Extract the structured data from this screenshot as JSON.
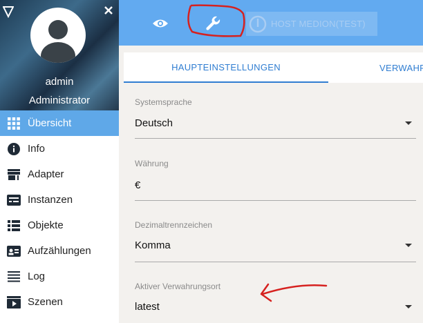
{
  "sidebar": {
    "user": {
      "name": "admin",
      "role": "Administrator"
    },
    "items": [
      {
        "label": "Übersicht",
        "icon": "grid-icon",
        "active": true
      },
      {
        "label": "Info",
        "icon": "info-icon"
      },
      {
        "label": "Adapter",
        "icon": "store-icon"
      },
      {
        "label": "Instanzen",
        "icon": "instances-icon"
      },
      {
        "label": "Objekte",
        "icon": "list-icon"
      },
      {
        "label": "Aufzählungen",
        "icon": "badge-icon"
      },
      {
        "label": "Log",
        "icon": "lines-icon"
      },
      {
        "label": "Szenen",
        "icon": "play-icon"
      }
    ]
  },
  "header": {
    "host_label": "HOST MEDION(TEST)",
    "icons": [
      "eye-icon",
      "wrench-icon",
      "power-icon"
    ]
  },
  "tabs": [
    {
      "label": "HAUPTEINSTELLUNGEN",
      "active": true
    },
    {
      "label": "VERWAHR"
    }
  ],
  "form": {
    "language": {
      "label": "Systemsprache",
      "value": "Deutsch"
    },
    "currency": {
      "label": "Währung",
      "value": "€"
    },
    "decimal": {
      "label": "Dezimaltrennzeichen",
      "value": "Komma"
    },
    "storage": {
      "label": "Aktiver Verwahrungsort",
      "value": "latest"
    }
  },
  "colors": {
    "header": "#62aaf0",
    "sidebar_active": "#5fa8e8",
    "tab_accent": "#2f7dd1",
    "annotation": "#d6211f"
  }
}
